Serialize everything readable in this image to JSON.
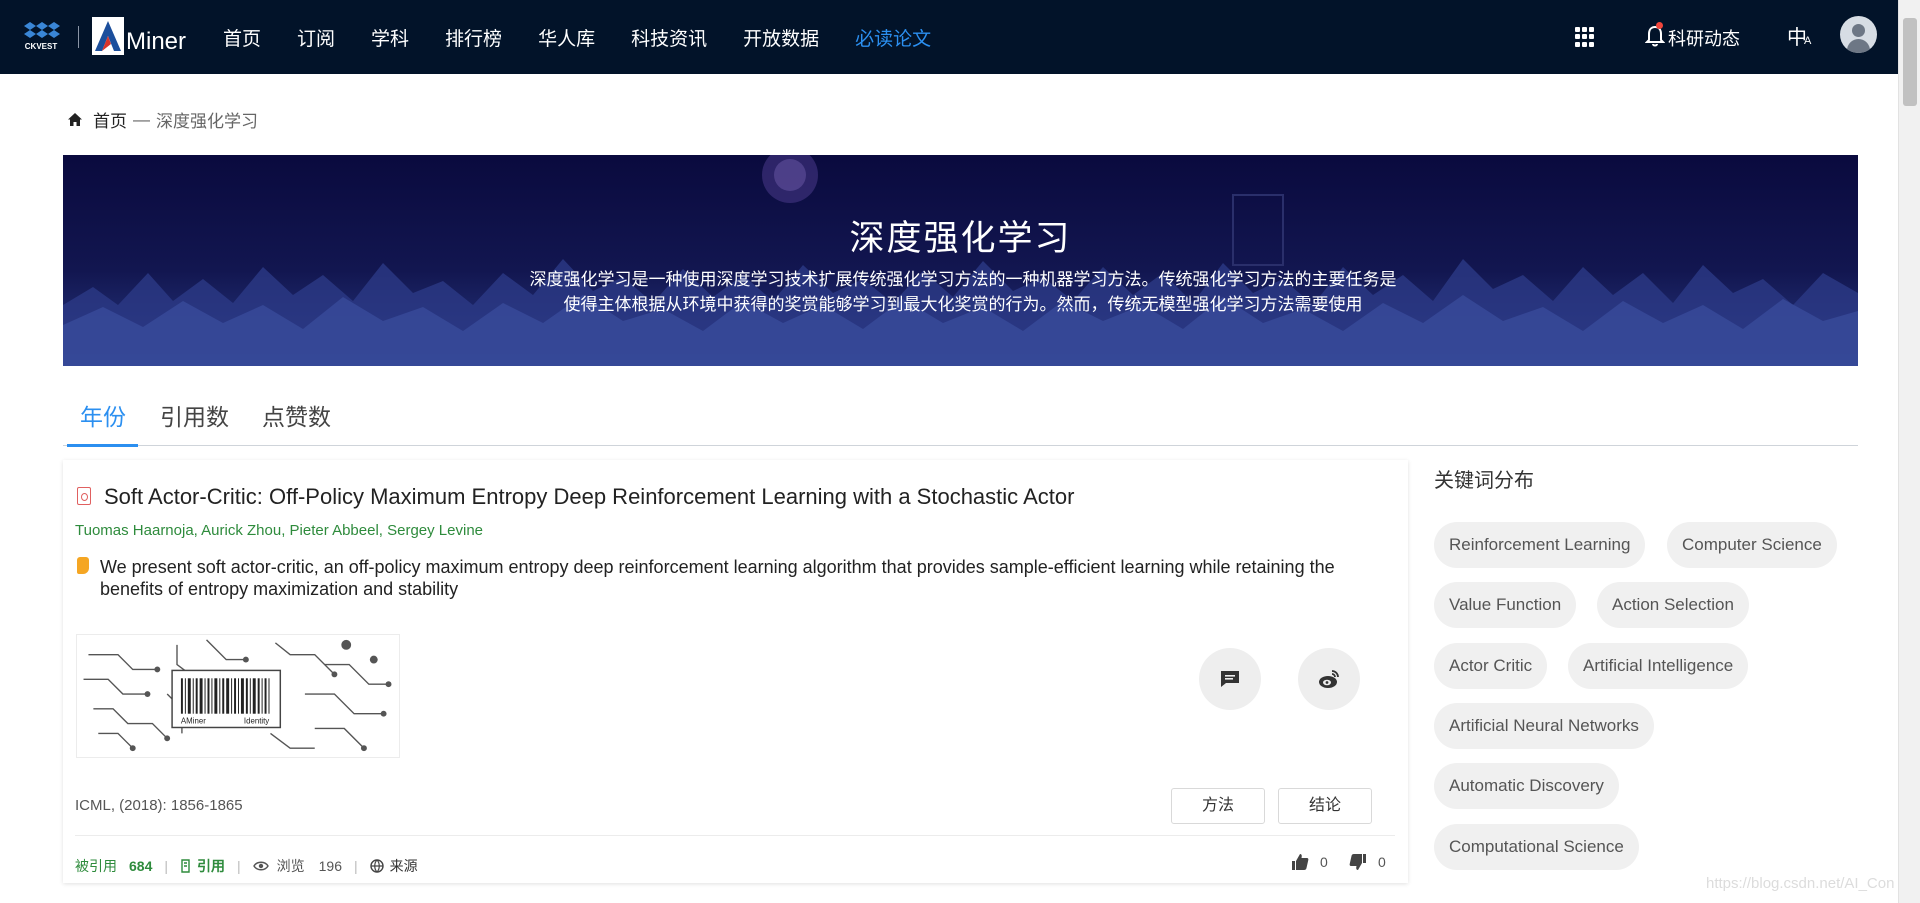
{
  "nav": {
    "items": [
      "首页",
      "订阅",
      "学科",
      "排行榜",
      "华人库",
      "科技资讯",
      "开放数据",
      "必读论文"
    ],
    "active_index": 7,
    "keyan_label": "科研动态",
    "lang_zh": "中",
    "lang_en": "A",
    "logo_word": "Miner",
    "logo_ckvest": "CKVEST"
  },
  "breadcrumb": {
    "home": "首页",
    "sep": "—",
    "current": "深度强化学习"
  },
  "banner": {
    "title": "深度强化学习",
    "desc": "深度强化学习是一种使用深度学习技术扩展传统强化学习方法的一种机器学习方法。传统强化学习方法的主要任务是使得主体根据从环境中获得的奖赏能够学习到最大化奖赏的行为。然而，传统无模型强化学习方法需要使用"
  },
  "tabs": [
    "年份",
    "引用数",
    "点赞数"
  ],
  "paper": {
    "title": "Soft Actor-Critic: Off-Policy Maximum Entropy Deep Reinforcement Learning with a Stochastic Actor",
    "authors": "Tuomas Haarnoja, Aurick Zhou, Pieter Abbeel, Sergey Levine",
    "abstract": "We present soft actor-critic, an off-policy maximum entropy deep reinforcement learning algorithm that provides sample-efficient learning while retaining the benefits of entropy maximization and stability",
    "thumb_text_left": "AMiner",
    "thumb_text_right": "Identity",
    "venue": "ICML, (2018): 1856-1865",
    "tag_method": "方法",
    "tag_conclusion": "结论",
    "cited_label": "被引用",
    "cited_count": "684",
    "cite_label": "引用",
    "views_label": "浏览",
    "views_count": "196",
    "source_label": "来源",
    "likes": "0",
    "dislikes": "0"
  },
  "keywords": {
    "title": "关键词分布",
    "items": [
      "Reinforcement Learning",
      "Computer Science",
      "Value Function",
      "Action Selection",
      "Actor Critic",
      "Artificial Intelligence",
      "Artificial Neural Networks",
      "Automatic Discovery",
      "Computational Science"
    ]
  },
  "watermark": "https://blog.csdn.net/AI_Con",
  "colors": {
    "nav_bg": "#021329",
    "accent": "#2b8ff0",
    "author_green": "#2e8b3c",
    "quote_orange": "#f5a623"
  }
}
